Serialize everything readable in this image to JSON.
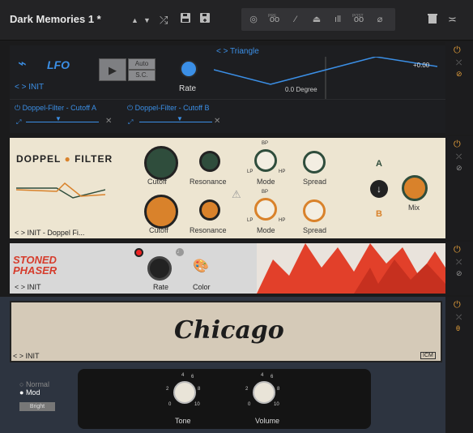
{
  "topbar": {
    "title": "Dark Memories 1 *",
    "icons": [
      "chevron-up-icon",
      "chevron-down-icon",
      "shuffle-icon",
      "save-icon",
      "save-as-icon"
    ],
    "group": [
      {
        "name": "tuner-icon",
        "tag": ""
      },
      {
        "name": "pre-icon",
        "tag": "PRE"
      },
      {
        "name": "pick-icon",
        "tag": ""
      },
      {
        "name": "metronome-icon",
        "tag": ""
      },
      {
        "name": "meter-icon",
        "tag": ""
      },
      {
        "name": "post-icon",
        "tag": "POST"
      },
      {
        "name": "tape-icon",
        "tag": ""
      }
    ],
    "right_icons": [
      "trash-icon",
      "collapse-icon"
    ]
  },
  "lfo": {
    "name": "LFO",
    "preset": "< > INIT",
    "auto": "Auto",
    "sc": "S.C.",
    "rate_label": "Rate",
    "waveform": "< > Triangle",
    "value": "+0.00",
    "phase": "0.0 Degree",
    "targets": [
      {
        "label": "Doppel-Filter - Cutoff A"
      },
      {
        "label": "Doppel-Filter - Cutoff B"
      }
    ]
  },
  "doppel": {
    "title_left": "DOPPEL",
    "title_right": "FILTER",
    "preset": "< > INIT - Doppel Fi...",
    "row_a": {
      "k1": "Cutoff",
      "k2": "Resonance",
      "k3": "Mode",
      "k4": "Spread",
      "bp": "BP",
      "lp": "LP",
      "hp": "HP"
    },
    "row_b": {
      "k1": "Cutoff",
      "k2": "Resonance",
      "k3": "Mode",
      "k4": "Spread",
      "bp": "BP",
      "lp": "LP",
      "hp": "HP"
    },
    "a": "A",
    "b": "B",
    "mix": "Mix",
    "colors": {
      "a": "#2f4d3c",
      "b": "#d9822b"
    }
  },
  "phaser": {
    "logo_top": "STONED",
    "logo_bottom": "PHASER",
    "preset": "< > INIT",
    "rate": "Rate",
    "color": "Color"
  },
  "amp": {
    "name": "Chicago",
    "preset": "< > INIT",
    "logo": "ICM",
    "normal": "Normal",
    "mod": "Mod",
    "bright": "Bright",
    "tone": "Tone",
    "volume": "Volume",
    "scale_top": "4",
    "scale_tr": "6",
    "scale_r": "8",
    "scale_l": "2",
    "scale_bl": "0",
    "scale_br": "10"
  }
}
